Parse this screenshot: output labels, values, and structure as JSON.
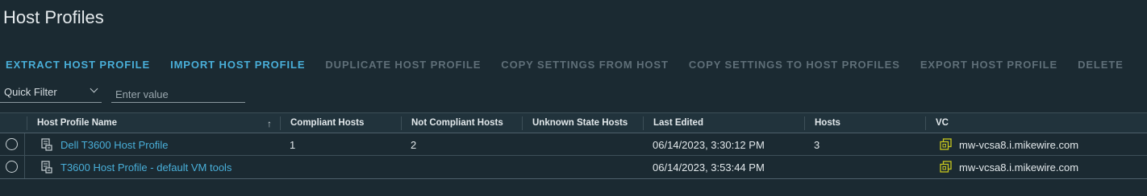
{
  "page": {
    "title": "Host Profiles"
  },
  "toolbar": {
    "buttons": [
      {
        "label": "EXTRACT HOST PROFILE",
        "enabled": true
      },
      {
        "label": "IMPORT HOST PROFILE",
        "enabled": true
      },
      {
        "label": "DUPLICATE HOST PROFILE",
        "enabled": false
      },
      {
        "label": "COPY SETTINGS FROM HOST",
        "enabled": false
      },
      {
        "label": "COPY SETTINGS TO HOST PROFILES",
        "enabled": false
      },
      {
        "label": "EXPORT HOST PROFILE",
        "enabled": false
      },
      {
        "label": "DELETE",
        "enabled": false
      }
    ]
  },
  "filter": {
    "quick_filter_label": "Quick Filter",
    "placeholder": "Enter value"
  },
  "grid": {
    "columns": [
      "Host Profile Name",
      "Compliant Hosts",
      "Not Compliant Hosts",
      "Unknown State Hosts",
      "Last Edited",
      "Hosts",
      "VC"
    ],
    "sort_icon": "↑",
    "rows": [
      {
        "name": "Dell T3600 Host Profile",
        "compliant": "1",
        "not_compliant": "2",
        "unknown": "",
        "last_edited": "06/14/2023, 3:30:12 PM",
        "hosts": "3",
        "vc": "mw-vcsa8.i.mikewire.com"
      },
      {
        "name": "T3600 Host Profile - default VM tools",
        "compliant": "",
        "not_compliant": "",
        "unknown": "",
        "last_edited": "06/14/2023, 3:53:44 PM",
        "hosts": "",
        "vc": "mw-vcsa8.i.mikewire.com"
      }
    ]
  },
  "colors": {
    "accent": "#49afd9",
    "disabled": "#5f6f78",
    "background": "#1b2a32",
    "vc_icon": "#c8c81e"
  },
  "icons": {
    "profile": "host-profile-icon",
    "vc": "vcenter-icon",
    "sort": "sort-ascending-icon",
    "dropdown": "chevron-down-icon"
  }
}
